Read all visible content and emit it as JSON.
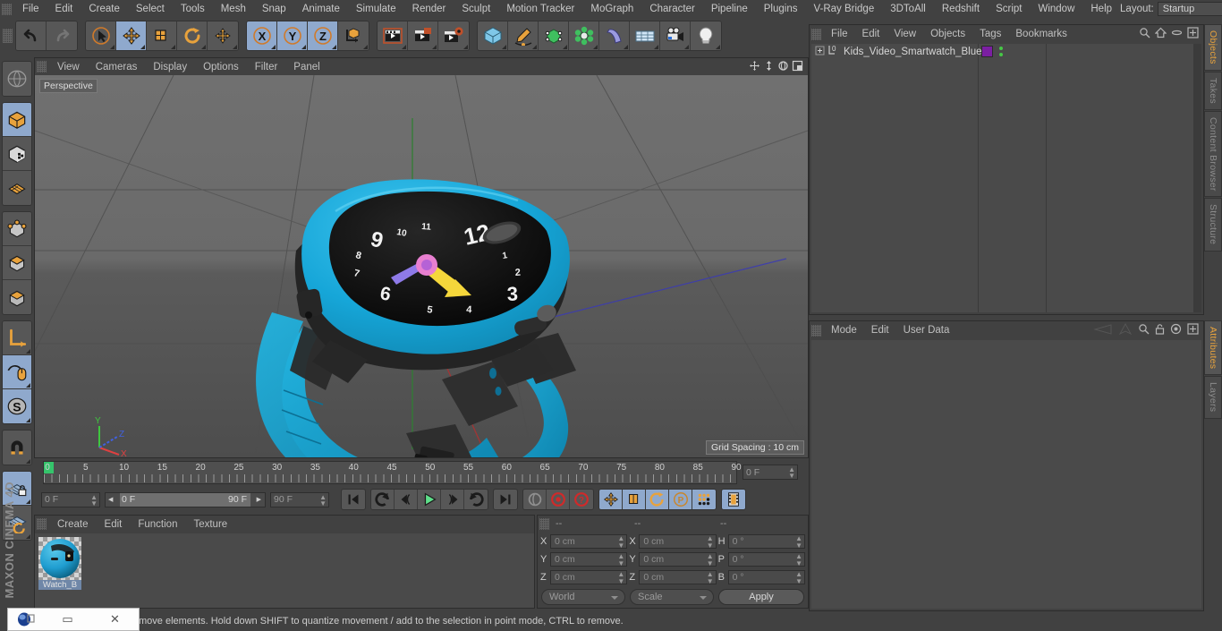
{
  "app": {
    "title": "CINEMA 4D",
    "brand": "MAXON"
  },
  "menubar": {
    "items": [
      "File",
      "Edit",
      "Create",
      "Select",
      "Tools",
      "Mesh",
      "Snap",
      "Animate",
      "Simulate",
      "Render",
      "Sculpt",
      "Motion Tracker",
      "MoGraph",
      "Character",
      "Pipeline",
      "Plugins",
      "V-Ray Bridge",
      "3DToAll",
      "Redshift",
      "Script",
      "Window",
      "Help"
    ],
    "layout_label": "Layout:",
    "layout_value": "Startup",
    "search_icon": "search-icon"
  },
  "toolbar": {
    "groups": [
      {
        "name": "undo-redo",
        "buttons": [
          {
            "icon": "undo-icon",
            "label": "Undo",
            "active": false
          },
          {
            "icon": "redo-icon",
            "label": "Redo",
            "active": false
          }
        ]
      },
      {
        "name": "tools",
        "buttons": [
          {
            "icon": "live-selection-icon",
            "label": "Live Selection",
            "active": false
          },
          {
            "icon": "move-icon",
            "label": "Move",
            "active": true
          },
          {
            "icon": "scale-icon",
            "label": "Scale",
            "active": false
          },
          {
            "icon": "rotate-icon",
            "label": "Rotate",
            "active": false
          },
          {
            "icon": "move-alt-icon",
            "label": "Move Alt",
            "active": false
          }
        ]
      },
      {
        "name": "axis-locks",
        "buttons": [
          {
            "icon": "x-axis-icon",
            "label": "X",
            "active": true
          },
          {
            "icon": "y-axis-icon",
            "label": "Y",
            "active": true
          },
          {
            "icon": "z-axis-icon",
            "label": "Z",
            "active": true
          },
          {
            "icon": "world-object-axis-icon",
            "label": "World/Object",
            "active": false
          }
        ]
      },
      {
        "name": "render",
        "buttons": [
          {
            "icon": "render-view-icon",
            "label": "Render View",
            "active": false
          },
          {
            "icon": "render-region-icon",
            "label": "Render to Picture Viewer",
            "active": false
          },
          {
            "icon": "render-settings-icon",
            "label": "Edit Render Settings",
            "active": false
          }
        ]
      },
      {
        "name": "creation",
        "buttons": [
          {
            "icon": "cube-primitive-icon",
            "label": "Add Cube Object",
            "active": false
          },
          {
            "icon": "spline-pen-icon",
            "label": "Add Spline",
            "active": false
          },
          {
            "icon": "nurbs-icon",
            "label": "Add Generator",
            "active": false
          },
          {
            "icon": "array-icon",
            "label": "Add Array",
            "active": false
          },
          {
            "icon": "deformer-icon",
            "label": "Add Bend Object",
            "active": false
          },
          {
            "icon": "floor-icon",
            "label": "Add Scene Object",
            "active": false
          },
          {
            "icon": "camera-icon",
            "label": "Add Camera",
            "active": false
          },
          {
            "icon": "light-icon",
            "label": "Add Light",
            "active": false
          }
        ]
      }
    ]
  },
  "left_toolbar": {
    "groups": [
      {
        "buttons": [
          {
            "icon": "make-editable-icon",
            "label": "Make Editable",
            "active": false
          }
        ]
      },
      {
        "buttons": [
          {
            "icon": "model-mode-icon",
            "label": "Model Mode",
            "active": true
          },
          {
            "icon": "texture-mode-icon",
            "label": "Texture Mode",
            "active": false
          },
          {
            "icon": "polygon-mode-icon",
            "label": "Polygon Mode",
            "active": false
          }
        ]
      },
      {
        "buttons": [
          {
            "icon": "points-mode-icon",
            "label": "Points Mode",
            "active": false
          },
          {
            "icon": "edges-mode-icon",
            "label": "Edges Mode",
            "active": false
          },
          {
            "icon": "faces-mode-icon",
            "label": "Faces Mode",
            "active": false
          }
        ]
      },
      {
        "buttons": [
          {
            "icon": "axis-modify-icon",
            "label": "Enable Axis Modification",
            "active": false
          },
          {
            "icon": "viewport-solo-icon",
            "label": "Viewport Solo",
            "active": true
          },
          {
            "icon": "soft-selection-icon",
            "label": "Soft Selection",
            "active": true
          }
        ]
      },
      {
        "buttons": [
          {
            "icon": "magnet-icon",
            "label": "Magnet",
            "active": false
          }
        ]
      },
      {
        "buttons": [
          {
            "icon": "workplane-lock-icon",
            "label": "Lock Workplane",
            "active": true
          },
          {
            "icon": "workplane-rotate-icon",
            "label": "Rotate Workplane",
            "active": false
          }
        ]
      }
    ]
  },
  "viewport": {
    "menu": [
      "View",
      "Cameras",
      "Display",
      "Options",
      "Filter",
      "Panel"
    ],
    "label": "Perspective",
    "grid_spacing": "Grid Spacing : 10 cm",
    "axis_gizmo": {
      "x": "X",
      "y": "Y",
      "z": "Z",
      "x_color": "#e04040",
      "y_color": "#3fc63f",
      "z_color": "#4060e0"
    },
    "icons": [
      "pan-icon",
      "dolly-icon",
      "orbit-icon",
      "maximize-icon"
    ],
    "scene_object": {
      "name": "Kids Video Smartwatch",
      "body_color": "#17a8d8",
      "face_color": "#1a1a1a",
      "hand_colors": [
        "#f5d73b",
        "#e87fd0",
        "#8e7ae8"
      ],
      "clock_numbers": [
        "12",
        "1",
        "2",
        "3",
        "4",
        "5",
        "6",
        "7",
        "8",
        "9",
        "10",
        "11"
      ]
    }
  },
  "timeline": {
    "ticks": [
      0,
      5,
      10,
      15,
      20,
      25,
      30,
      35,
      40,
      45,
      50,
      55,
      60,
      65,
      70,
      75,
      80,
      85,
      90
    ],
    "current_frame_field": "0 F",
    "start_field": "0 F",
    "slider_start": "0 F",
    "slider_end": "90 F",
    "end_field": "90 F"
  },
  "transport": {
    "buttons": [
      {
        "icon": "go-to-start-icon",
        "label": "Go to Start",
        "active": false
      },
      {
        "icon": "previous-keyframe-icon",
        "label": "Go to Previous Key",
        "active": false
      },
      {
        "icon": "previous-frame-icon",
        "label": "Go to Previous Frame",
        "active": false
      },
      {
        "icon": "play-icon",
        "label": "Play Forwards",
        "active": false
      },
      {
        "icon": "next-frame-icon",
        "label": "Go to Next Frame",
        "active": false
      },
      {
        "icon": "next-keyframe-icon",
        "label": "Go to Next Key",
        "active": false
      },
      {
        "icon": "go-to-end-icon",
        "label": "Go to End",
        "active": false
      }
    ],
    "record_buttons": [
      {
        "icon": "autokey-icon",
        "label": "Autokeying",
        "active": false
      },
      {
        "icon": "record-icon",
        "label": "Record Active Objects",
        "active": false
      },
      {
        "icon": "keyframe-selection-icon",
        "label": "Keyframe Selection",
        "active": false
      }
    ],
    "toggle_buttons": [
      {
        "icon": "position-key-icon",
        "label": "Position",
        "active": true
      },
      {
        "icon": "scale-key-icon",
        "label": "Scale",
        "active": true
      },
      {
        "icon": "rotation-key-icon",
        "label": "Rotation",
        "active": true
      },
      {
        "icon": "param-key-icon",
        "label": "Parameter",
        "active": true
      },
      {
        "icon": "pla-key-icon",
        "label": "Point Level Animation",
        "active": true
      }
    ],
    "extra_button": {
      "icon": "timeline-strip-icon",
      "label": "Animation Mode",
      "active": true
    }
  },
  "material_manager": {
    "menu": [
      "Create",
      "Edit",
      "Function",
      "Texture"
    ],
    "materials": [
      {
        "name": "Watch_B",
        "color": "#1f9dd0"
      }
    ]
  },
  "coordinates": {
    "headers": [
      "--",
      "--",
      "--"
    ],
    "rows": [
      {
        "pos_label": "X",
        "pos_value": "0 cm",
        "size_label": "X",
        "size_value": "0 cm",
        "rot_label": "H",
        "rot_value": "0 °"
      },
      {
        "pos_label": "Y",
        "pos_value": "0 cm",
        "size_label": "Y",
        "size_value": "0 cm",
        "rot_label": "P",
        "rot_value": "0 °"
      },
      {
        "pos_label": "Z",
        "pos_value": "0 cm",
        "size_label": "Z",
        "size_value": "0 cm",
        "rot_label": "B",
        "rot_value": "0 °"
      }
    ],
    "coord_system": "World",
    "transform_mode": "Scale",
    "apply_label": "Apply"
  },
  "object_manager": {
    "menu": [
      "File",
      "Edit",
      "View",
      "Objects",
      "Tags",
      "Bookmarks"
    ],
    "icons": [
      "search-icon",
      "home-icon",
      "ellipse-icon",
      "plus-box-icon"
    ],
    "rows": [
      {
        "name": "Kids_Video_Smartwatch_Blue",
        "tag_color": "#7b1fa2",
        "expandable": true
      }
    ]
  },
  "attribute_manager": {
    "menu": [
      "Mode",
      "Edit",
      "User Data"
    ],
    "icons": [
      "layout-left-icon",
      "layout-up-icon",
      "search-icon",
      "lock-icon",
      "target-icon",
      "plus-box-icon"
    ]
  },
  "side_tabs": {
    "top": [
      {
        "label": "Objects",
        "active": true
      },
      {
        "label": "Takes",
        "active": false
      },
      {
        "label": "Content Browser",
        "active": false
      },
      {
        "label": "Structure",
        "active": false
      }
    ],
    "bottom": [
      {
        "label": "Attributes",
        "active": true
      },
      {
        "label": "Layers",
        "active": false
      }
    ]
  },
  "statusbar": {
    "text": "move elements. Hold down SHIFT to quantize movement / add to the selection in point mode, CTRL to remove."
  },
  "mini_window": {
    "icons": [
      "app-icon",
      "restore-icon",
      "minimize-icon",
      "close-icon"
    ]
  }
}
